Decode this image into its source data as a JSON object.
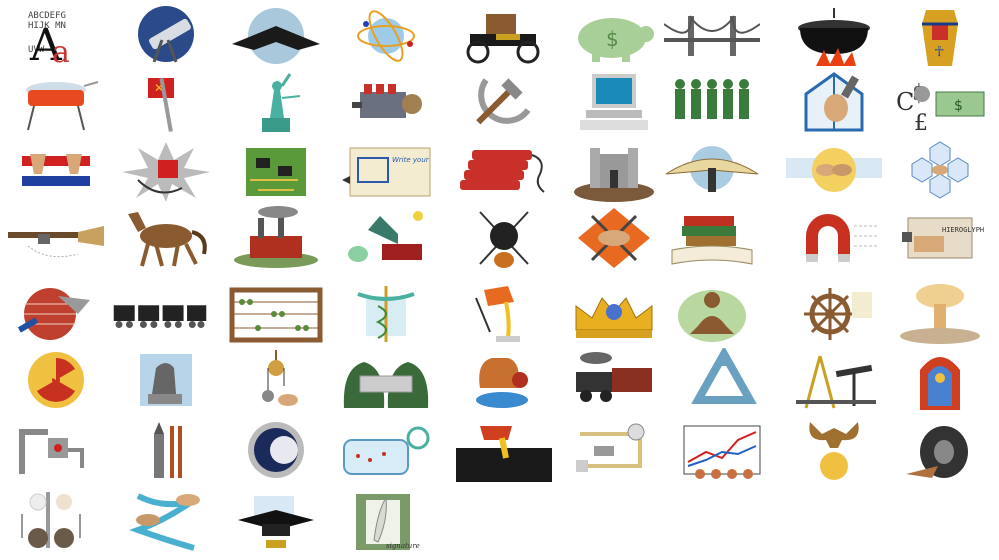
{
  "gallery": {
    "letters": {
      "specimen_lines": [
        "ABCDEFG",
        "HIJK MN",
        "UVW"
      ],
      "big_a": "A",
      "small_a": "a"
    },
    "currency": {
      "symbols": [
        "C",
        "$",
        "£"
      ]
    },
    "banknote": {
      "text": "$"
    },
    "piggy_bank": {
      "text": "$"
    },
    "scroll": {
      "script": "Write your"
    },
    "hieroglyph": {
      "text": "HIEROGLYPH"
    },
    "signature": {
      "text": "signature"
    },
    "icons": [
      "alphabet-letters-icon",
      "telescope-icon",
      "stealth-bomber-icon",
      "atom-globe-icon",
      "antique-car-icon",
      "piggy-bank-icon",
      "suspension-bridge-icon",
      "cauldron-fire-icon",
      "pharaoh-sarcophagus-icon",
      "dome-stove-icon",
      "flag-sword-icon",
      "statue-of-liberty-icon",
      "engine-icon",
      "hammer-sickle-icon",
      "computer-icon",
      "soldiers-icon",
      "greenhouse-hand-icon",
      "currency-symbols-icon",
      "flag-hands-icon",
      "explosion-icon",
      "circuit-board-icon",
      "blueprint-icon",
      "dynamite-icon",
      "castle-icon",
      "glider-icon",
      "clasped-hands-globe-icon",
      "network-nodes-icon",
      "musket-icon",
      "horse-icon",
      "factory-icon",
      "gramophone-icon",
      "spears-shield-icon",
      "handshake-swords-icon",
      "books-icon",
      "magnet-icon",
      "stamp-pad-icon",
      "brick-trowel-icon",
      "train-cars-icon",
      "abacus-icon",
      "caduceus-icon",
      "crucible-icon",
      "crown-icon",
      "meditating-figure-icon",
      "ships-wheel-icon",
      "mushroom-cloud-icon",
      "radiation-icon",
      "thinker-statue-icon",
      "pulley-icon",
      "money-bags-icon",
      "pottery-icon",
      "locomotive-icon",
      "recycle-icon",
      "oil-derrick-icon",
      "cathedral-window-icon",
      "robot-arm-icon",
      "rocket-launch-icon",
      "moon-window-icon",
      "laboratory-tank-icon",
      "steel-mill-icon",
      "schematic-icon",
      "line-chart-icon",
      "eagle-globe-icon",
      "tire-icon",
      "falling-balls-icon",
      "dna-hands-icon",
      "graduation-cap-icon",
      "quill-paper-icon"
    ]
  }
}
